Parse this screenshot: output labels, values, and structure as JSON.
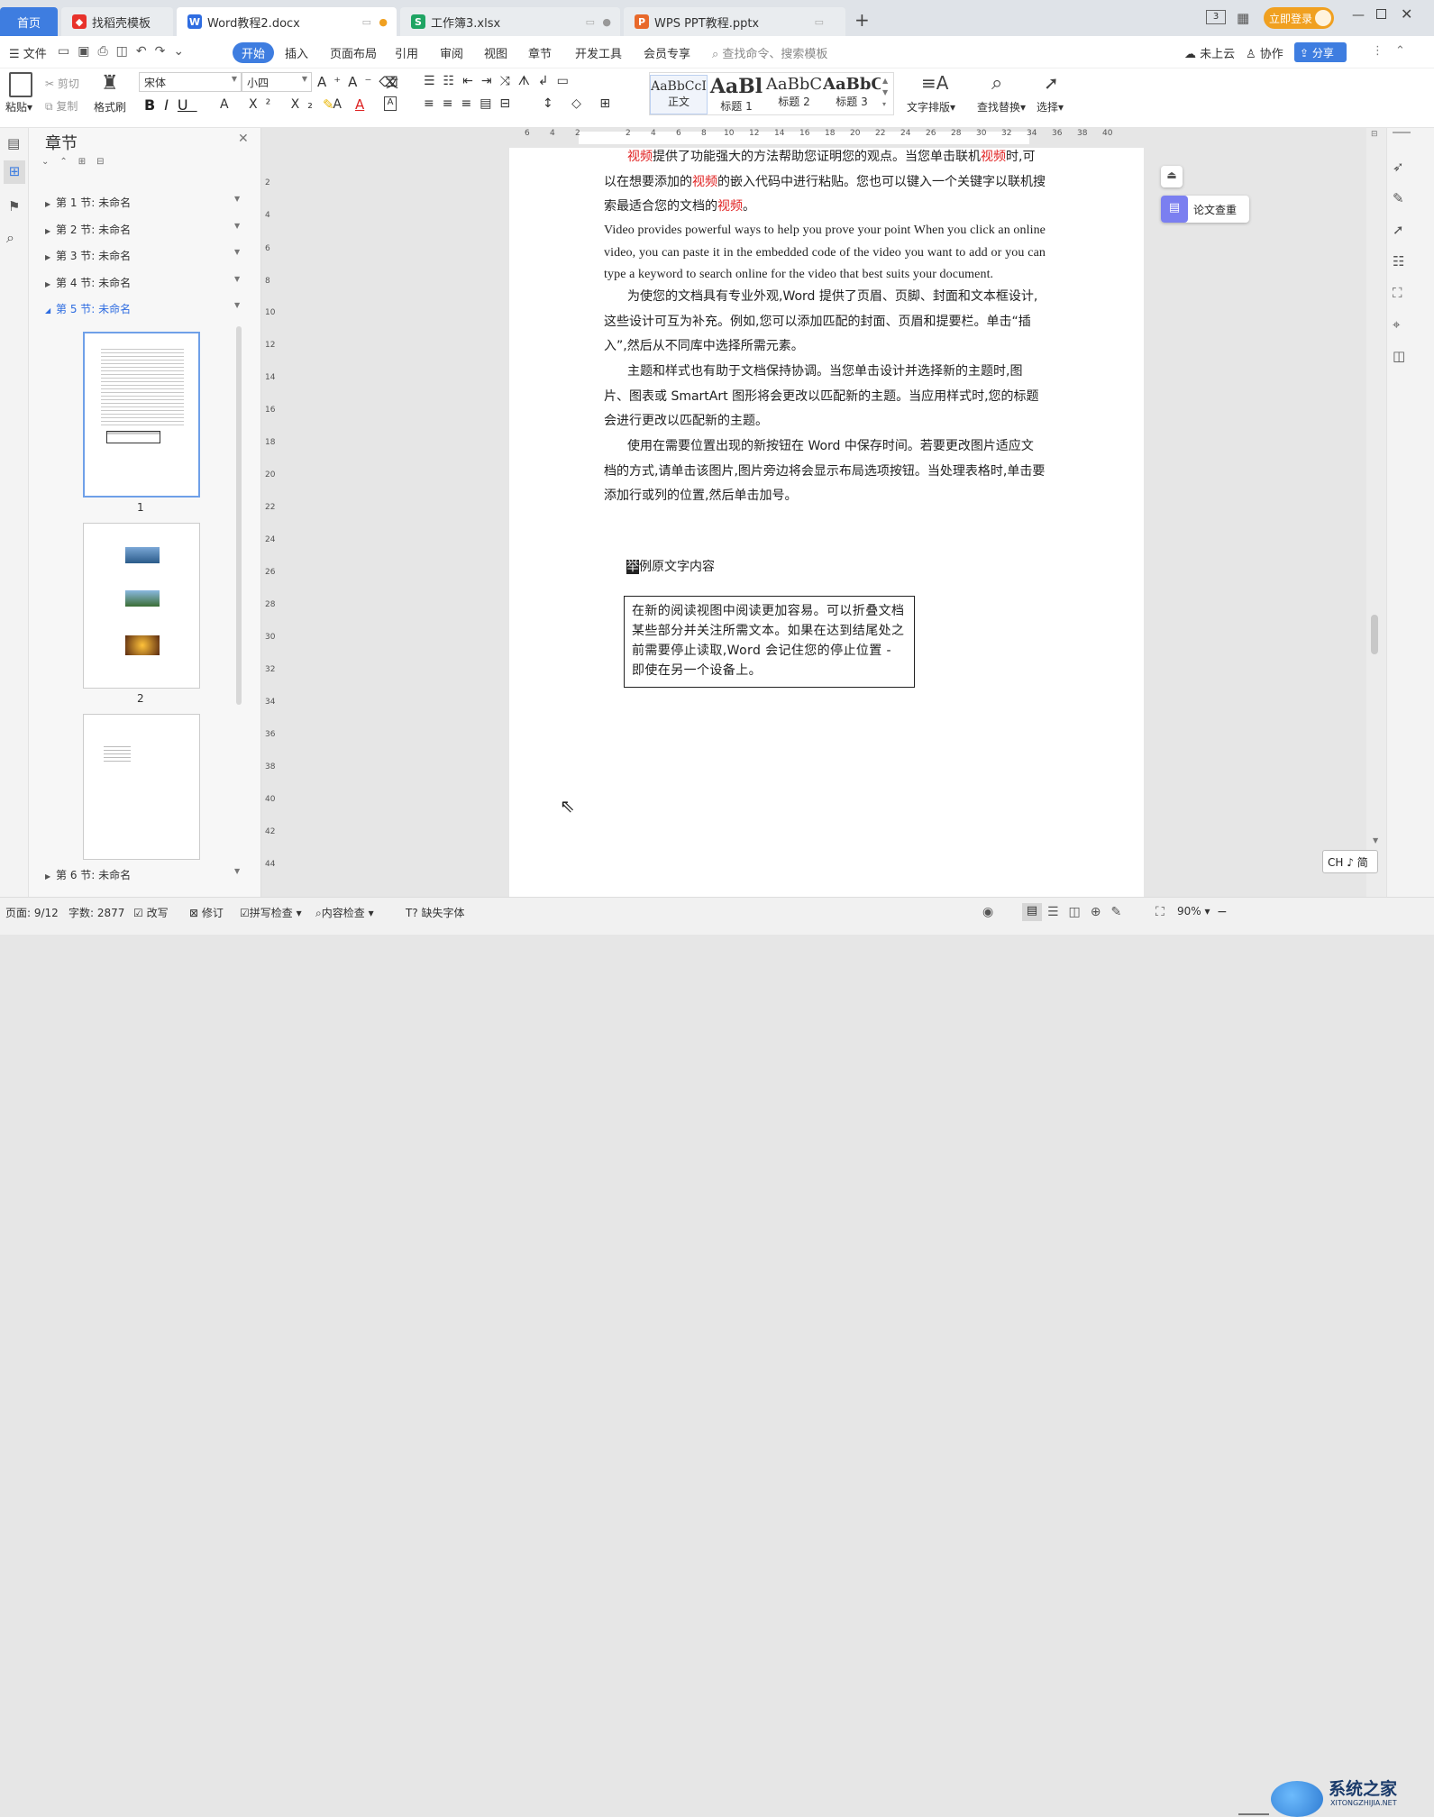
{
  "tabs": {
    "home": "首页",
    "t1": "找稻壳模板",
    "t2": "Word教程2.docx",
    "t3": "工作簿3.xlsx",
    "t4": "WPS PPT教程.pptx",
    "new_tab": "+",
    "login": "立即登录"
  },
  "menu": {
    "file": "文件",
    "items": [
      "开始",
      "插入",
      "页面布局",
      "引用",
      "审阅",
      "视图",
      "章节",
      "开发工具",
      "会员专享"
    ],
    "search_placeholder": "查找命令、搜索模板",
    "cloud": "未上云",
    "collab": "协作",
    "share": "分享"
  },
  "ribbon": {
    "paste": "粘贴",
    "cut": "剪切",
    "copy": "复制",
    "format_painter": "格式刷",
    "font_name": "宋体",
    "font_size": "小四",
    "styles": [
      {
        "preview": "AaBbCcI",
        "label": "正文"
      },
      {
        "preview": "AaBl",
        "label": "标题 1"
      },
      {
        "preview": "AaBbC",
        "label": "标题 2"
      },
      {
        "preview": "AaBbC",
        "label": "标题 3"
      }
    ],
    "text_layout": "文字排版",
    "find_replace": "查找替换",
    "select": "选择"
  },
  "nav": {
    "title": "章节",
    "sections": [
      "第 1 节: 未命名",
      "第 2 节: 未命名",
      "第 3 节: 未命名",
      "第 4 节: 未命名",
      "第 5 节: 未命名",
      "第 6 节: 未命名"
    ],
    "page1": "1",
    "page2": "2"
  },
  "ruler": {
    "h": [
      "6",
      "4",
      "2",
      "",
      "2",
      "4",
      "6",
      "8",
      "10",
      "12",
      "14",
      "16",
      "18",
      "20",
      "22",
      "24",
      "26",
      "28",
      "30",
      "32",
      "34",
      "36",
      "38",
      "40"
    ],
    "v": [
      "2",
      "4",
      "6",
      "8",
      "10",
      "12",
      "14",
      "16",
      "18",
      "20",
      "22",
      "24",
      "26",
      "28",
      "30",
      "32",
      "34",
      "36",
      "38",
      "40",
      "42",
      "44"
    ]
  },
  "doc": {
    "p1a": "视频",
    "p1b": "提供了功能强大的方法帮助您证明您的观点。当您单击联机",
    "p1c": "视频",
    "p1d": "时,可以在想要添加的",
    "p1e": "视频",
    "p1f": "的嵌入代码中进行粘贴。您也可以键入一个关键字以联机搜索最适合您的文档的",
    "p1g": "视频",
    "p1h": "。",
    "en": "Video provides powerful ways to help you prove your point When you click an online video, you can paste it in the embedded code of the video you want to add or you can type a keyword to search online for the video that best suits your document.",
    "p2": "为使您的文档具有专业外观,Word 提供了页眉、页脚、封面和文本框设计,这些设计可互为补充。例如,您可以添加匹配的封面、页眉和提要栏。单击“插入”,然后从不同库中选择所需元素。",
    "p3": "主题和样式也有助于文档保持协调。当您单击设计并选择新的主题时,图片、图表或 SmartArt 图形将会更改以匹配新的主题。当应用样式时,您的标题会进行更改以匹配新的主题。",
    "p4": "使用在需要位置出现的新按钮在 Word 中保存时间。若要更改图片适应文档的方式,请单击该图片,图片旁边将会显示布局选项按钮。当处理表格时,单击要添加行或列的位置,然后单击加号。",
    "sample_mark": "举",
    "sample_title": "例原文字内容",
    "box": "在新的阅读视图中阅读更加容易。可以折叠文档某些部分并关注所需文本。如果在达到结尾处之前需要停止读取,Word 会记住您的停止位置 - 即使在另一个设备上。"
  },
  "side_panel": {
    "paper_check": "论文查重"
  },
  "ime": "CH ♪ 简",
  "status": {
    "page": "页面: 9/12",
    "words": "字数: 2877",
    "rewrite": "改写",
    "revise": "修订",
    "spell": "拼写检查",
    "content": "内容检查",
    "missing_font": "缺失字体",
    "zoom": "90%",
    "watermark": "系统之家",
    "watermark_sub": "XITONGZHIJIA.NET"
  },
  "colors": {
    "accent": "#3e7de0",
    "red_text": "#e02020",
    "login": "#f0a020"
  }
}
